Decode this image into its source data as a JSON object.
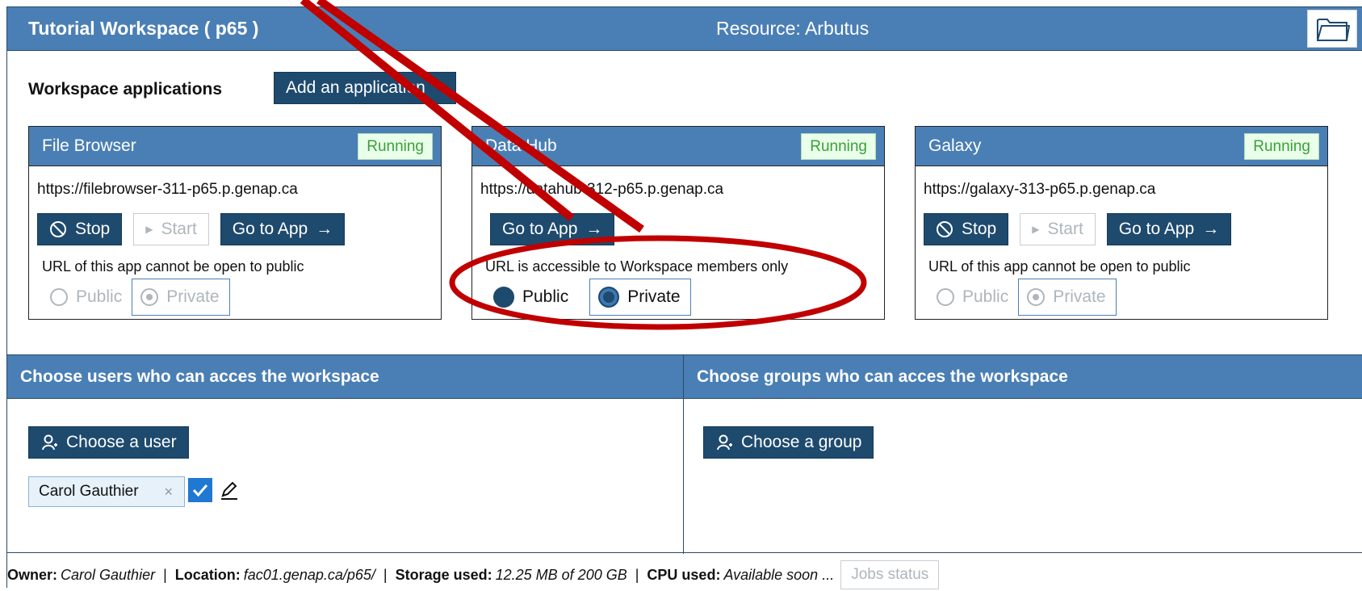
{
  "header": {
    "title": "Tutorial Workspace ( p65 )",
    "resource": "Resource: Arbutus",
    "folder_icon": "folder-icon"
  },
  "apps": {
    "heading": "Workspace applications",
    "add_label": "Add an application",
    "cards": [
      {
        "name": "File Browser",
        "status": "Running",
        "url": "https://filebrowser-311-p65.p.genap.ca",
        "stop_label": "Stop",
        "start_label": "Start",
        "goto_label": "Go to App",
        "note": "URL of this app cannot be open to public",
        "public_label": "Public",
        "private_label": "Private",
        "selected": "Private"
      },
      {
        "name": "Data Hub",
        "status": "Running",
        "url": "https://datahub-312-p65.p.genap.ca",
        "goto_label": "Go to App",
        "note": "URL is accessible to Workspace members only",
        "public_label": "Public",
        "private_label": "Private",
        "selected": "Private"
      },
      {
        "name": "Galaxy",
        "status": "Running",
        "url": "https://galaxy-313-p65.p.genap.ca",
        "stop_label": "Stop",
        "start_label": "Start",
        "goto_label": "Go to App",
        "note": "URL of this app cannot be open to public",
        "public_label": "Public",
        "private_label": "Private",
        "selected": "Private"
      }
    ]
  },
  "users": {
    "heading": "Choose users who can acces the workspace",
    "choose_label": "Choose a user",
    "tags": [
      {
        "name": "Carol Gauthier",
        "remove": "×"
      }
    ]
  },
  "groups": {
    "heading": "Choose groups who can acces the workspace",
    "choose_label": "Choose a group"
  },
  "footer": {
    "owner_key": "Owner:",
    "owner_val": "Carol Gauthier",
    "location_key": "Location:",
    "location_val": "fac01.genap.ca/p65/",
    "storage_key": "Storage used:",
    "storage_val": "12.25 MB of 200 GB",
    "cpu_key": "CPU used:",
    "cpu_val": "Available soon ...",
    "jobs_label": "Jobs status",
    "separator": "|"
  },
  "colors": {
    "header_blue": "#4a7fb5",
    "button_dark": "#1e4a6e",
    "running_green": "#3aa03a",
    "annotation_red": "#c00000"
  }
}
